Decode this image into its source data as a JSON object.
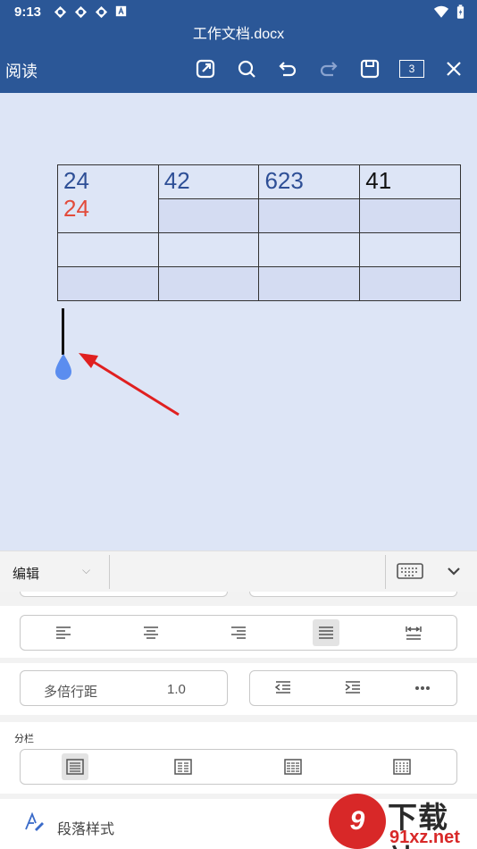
{
  "status_bar": {
    "time": "9:13"
  },
  "document": {
    "title": "工作文档.docx"
  },
  "toolbar": {
    "read_label": "阅读",
    "page_count": "3"
  },
  "table": {
    "rows": [
      [
        {
          "lines": [
            "24",
            "24"
          ]
        },
        {
          "lines": [
            "42"
          ]
        },
        {
          "lines": [
            "623"
          ]
        },
        {
          "lines": [
            "41"
          ]
        }
      ],
      [
        {
          "lines": [
            ""
          ]
        },
        {
          "lines": [
            ""
          ]
        },
        {
          "lines": [
            ""
          ]
        },
        {
          "lines": [
            ""
          ]
        }
      ],
      [
        {
          "lines": [
            ""
          ]
        },
        {
          "lines": [
            ""
          ]
        },
        {
          "lines": [
            ""
          ]
        },
        {
          "lines": [
            ""
          ]
        }
      ]
    ],
    "cell_colors": {
      "blue": "#2e4f96",
      "red": "#e24b3b",
      "black": "#111111"
    }
  },
  "edit_bar": {
    "mode": "编辑"
  },
  "panel": {
    "line_spacing_label": "多倍行距",
    "line_spacing_value": "1.0",
    "columns_label": "分栏",
    "paragraph_style_label": "段落样式"
  },
  "watermark": {
    "main": "下载站",
    "url": "91xz.net",
    "badge": "9"
  },
  "colors": {
    "header": "#2b5797",
    "doc_bg": "#dde5f6",
    "arrow": "#e02020",
    "handle": "#5b8def"
  }
}
